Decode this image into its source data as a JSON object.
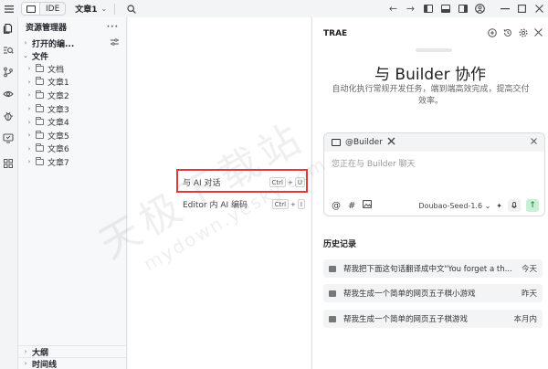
{
  "titlebar": {
    "mode_label": "IDE",
    "project_name": "文章1",
    "icons": [
      "menu-icon",
      "trae-logo-icon",
      "search-icon",
      "back-icon",
      "forward-icon",
      "layout-left-icon",
      "layout-bottom-icon",
      "layout-right-icon",
      "account-icon",
      "minimize-icon",
      "maximize-icon",
      "close-icon"
    ]
  },
  "activity_bar": {
    "icons": [
      "explorer-icon",
      "search-files-icon",
      "source-control-icon",
      "extensions-view-icon",
      "debug-icon",
      "remote-icon",
      "apps-icon"
    ]
  },
  "explorer": {
    "title": "资源管理器",
    "more": "···",
    "open_editors": "打开的编...",
    "files_section": "文件",
    "folders": [
      "文档",
      "文章1",
      "文章2",
      "文章3",
      "文章4",
      "文章5",
      "文章6",
      "文章7"
    ],
    "outline": "大纲",
    "timeline": "时间线"
  },
  "editor": {
    "shortcuts": [
      {
        "label": "与 AI 对话",
        "keys": [
          "Ctrl",
          "+",
          "U"
        ]
      },
      {
        "label": "Editor 内 AI 编码",
        "keys": [
          "Ctrl",
          "+",
          "I"
        ]
      }
    ],
    "highlight_color": "#e53935"
  },
  "chat": {
    "brand": "TRAE",
    "hero_title": "与 Builder 协作",
    "hero_subtitle": "自动化执行常规开发任务，端到端高效完成，提高交付效率。",
    "agent_chip": "@Builder",
    "input_placeholder": "您正在与 Builder 聊天",
    "model": "Doubao-Seed-1.6",
    "model_chevron": "⌄",
    "history_title": "历史记录",
    "history": [
      {
        "text": "帮我把下面这句话翻译成中文\"You forget a th...",
        "when": "今天"
      },
      {
        "text": "帮我生成一个简单的网页五子棋小游戏",
        "when": "昨天"
      },
      {
        "text": "帮我生成一个简单的网页五子棋游戏",
        "when": "本月内"
      }
    ],
    "send_color": "#1b9e4b"
  },
  "watermark": {
    "line1": "天极下载站",
    "line2": "mydown.yesky.com"
  }
}
